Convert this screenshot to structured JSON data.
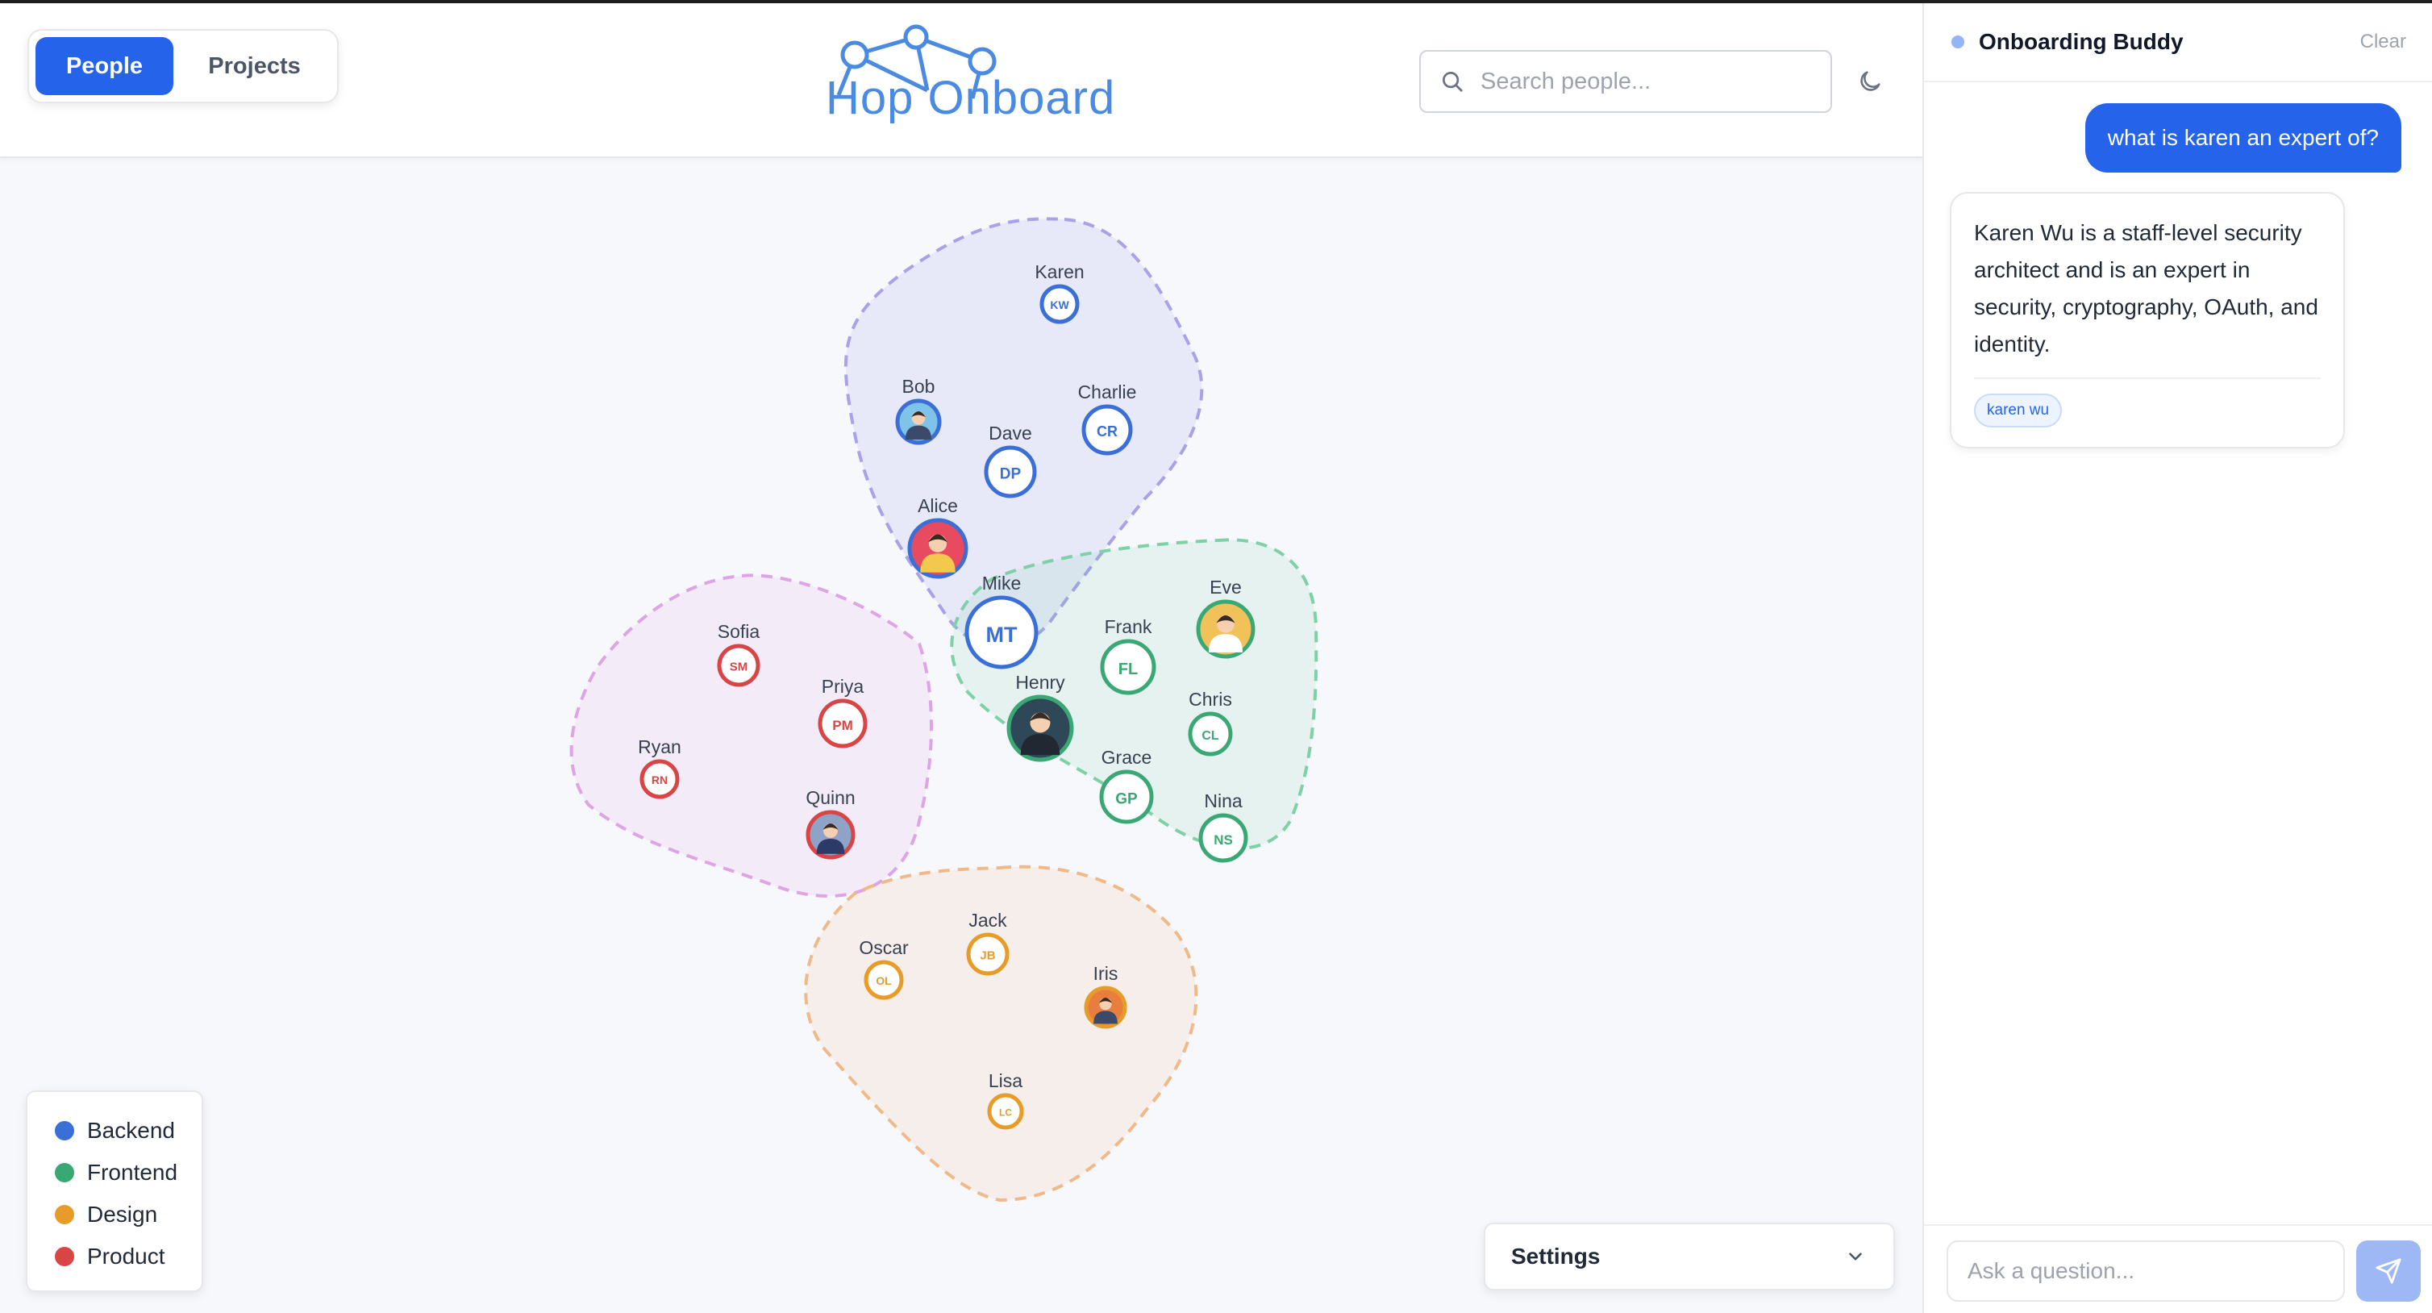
{
  "header": {
    "tabs": [
      {
        "label": "People",
        "active": true
      },
      {
        "label": "Projects",
        "active": false
      }
    ],
    "logo_text": "Hop Onboard",
    "search_placeholder": "Search people...",
    "icons": {
      "search": "search-icon",
      "theme": "moon-icon"
    }
  },
  "colors": {
    "accent": "#2563eb",
    "backend": "#3b6fd8",
    "frontend": "#3aa874",
    "design": "#e79c2a",
    "product": "#d94545"
  },
  "graph": {
    "nodes": [
      {
        "name": "Karen",
        "initials": "KW",
        "team": "backend"
      },
      {
        "name": "Bob",
        "initials": "",
        "team": "backend",
        "avatar": "person-avatar"
      },
      {
        "name": "Charlie",
        "initials": "CR",
        "team": "backend"
      },
      {
        "name": "Dave",
        "initials": "DP",
        "team": "backend"
      },
      {
        "name": "Alice",
        "initials": "",
        "team": "backend",
        "avatar": "person-avatar"
      },
      {
        "name": "Mike",
        "initials": "MT",
        "team": "backend"
      },
      {
        "name": "Eve",
        "initials": "",
        "team": "frontend",
        "avatar": "person-avatar"
      },
      {
        "name": "Frank",
        "initials": "FL",
        "team": "frontend"
      },
      {
        "name": "Henry",
        "initials": "",
        "team": "frontend",
        "avatar": "person-avatar"
      },
      {
        "name": "Chris",
        "initials": "CL",
        "team": "frontend"
      },
      {
        "name": "Grace",
        "initials": "GP",
        "team": "frontend"
      },
      {
        "name": "Nina",
        "initials": "NS",
        "team": "frontend"
      },
      {
        "name": "Sofia",
        "initials": "SM",
        "team": "product"
      },
      {
        "name": "Priya",
        "initials": "PM",
        "team": "product"
      },
      {
        "name": "Ryan",
        "initials": "RN",
        "team": "product"
      },
      {
        "name": "Quinn",
        "initials": "",
        "team": "product",
        "avatar": "person-avatar"
      },
      {
        "name": "Jack",
        "initials": "JB",
        "team": "design"
      },
      {
        "name": "Oscar",
        "initials": "OL",
        "team": "design"
      },
      {
        "name": "Iris",
        "initials": "",
        "team": "design",
        "avatar": "person-avatar"
      },
      {
        "name": "Lisa",
        "initials": "LC",
        "team": "design"
      }
    ]
  },
  "legend": [
    {
      "label": "Backend",
      "color": "#3b6fd8"
    },
    {
      "label": "Frontend",
      "color": "#3aa874"
    },
    {
      "label": "Design",
      "color": "#e79c2a"
    },
    {
      "label": "Product",
      "color": "#d94545"
    }
  ],
  "settings": {
    "label": "Settings",
    "icon": "chevron-down-icon"
  },
  "chat": {
    "title": "Onboarding Buddy",
    "clear_label": "Clear",
    "messages": [
      {
        "role": "user",
        "text": "what is karen an expert of?"
      },
      {
        "role": "assistant",
        "text": "Karen Wu is a staff-level security architect and is an expert in security, cryptography, OAuth, and identity.",
        "tags": [
          "karen wu"
        ]
      }
    ],
    "input_placeholder": "Ask a question...",
    "send_icon": "send-icon"
  }
}
